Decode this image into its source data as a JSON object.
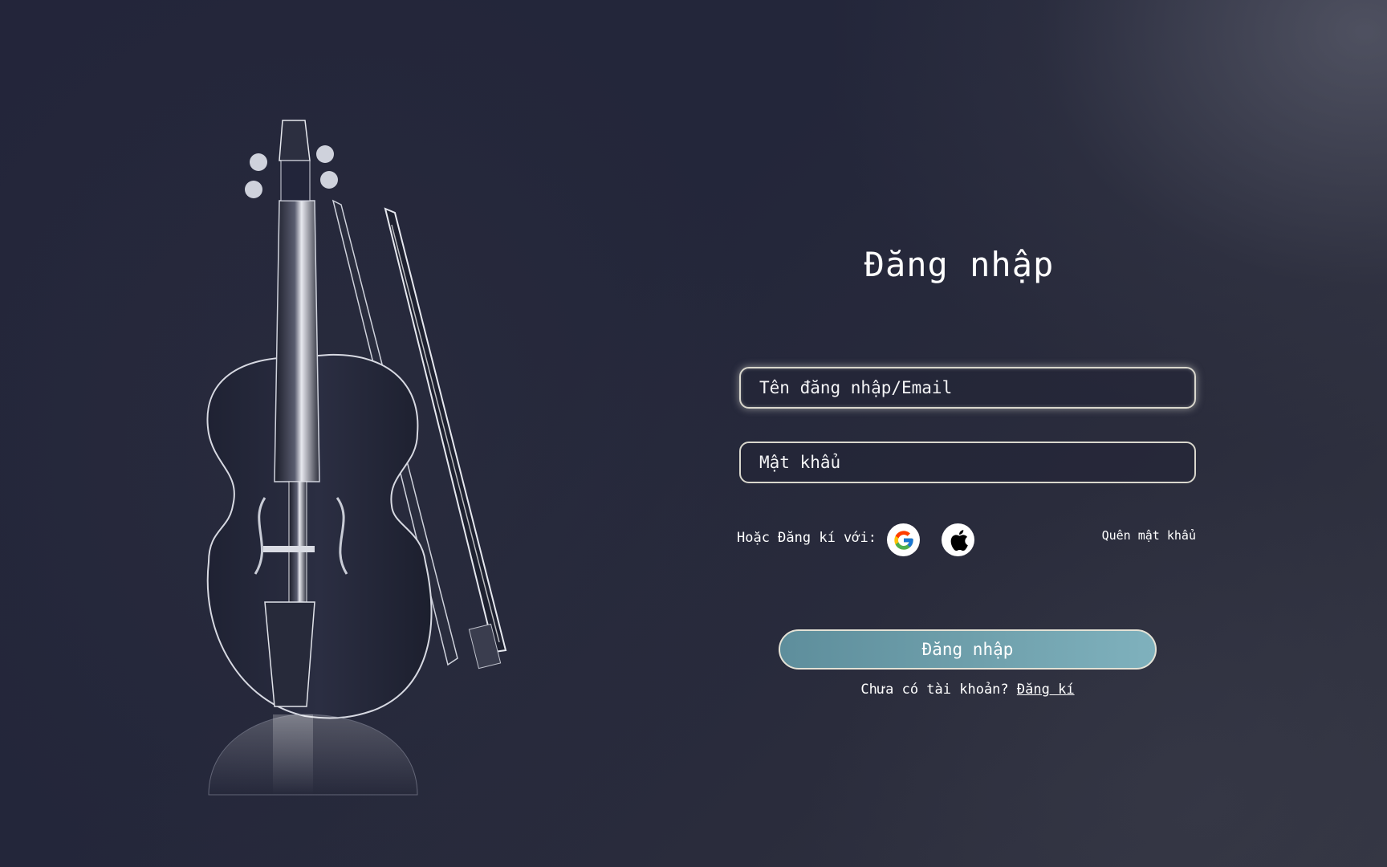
{
  "login": {
    "title": "Đăng nhập",
    "username_placeholder": "Tên đăng nhập/Email",
    "password_placeholder": "Mật khẩu",
    "alt_signup_label": "Hoặc Đăng kí với:",
    "social": [
      {
        "name": "google-icon"
      },
      {
        "name": "apple-icon"
      }
    ],
    "forgot_password": "Quên mật khẩu",
    "submit_label": "Đăng nhập",
    "no_account_text": "Chưa có tài khoản?",
    "signup_link": "Đăng kí"
  },
  "colors": {
    "background": "#23263a",
    "submit_button": "#6e9fab",
    "field_border": "#d9d7cd"
  },
  "illustration": {
    "name": "violin-and-bow"
  }
}
